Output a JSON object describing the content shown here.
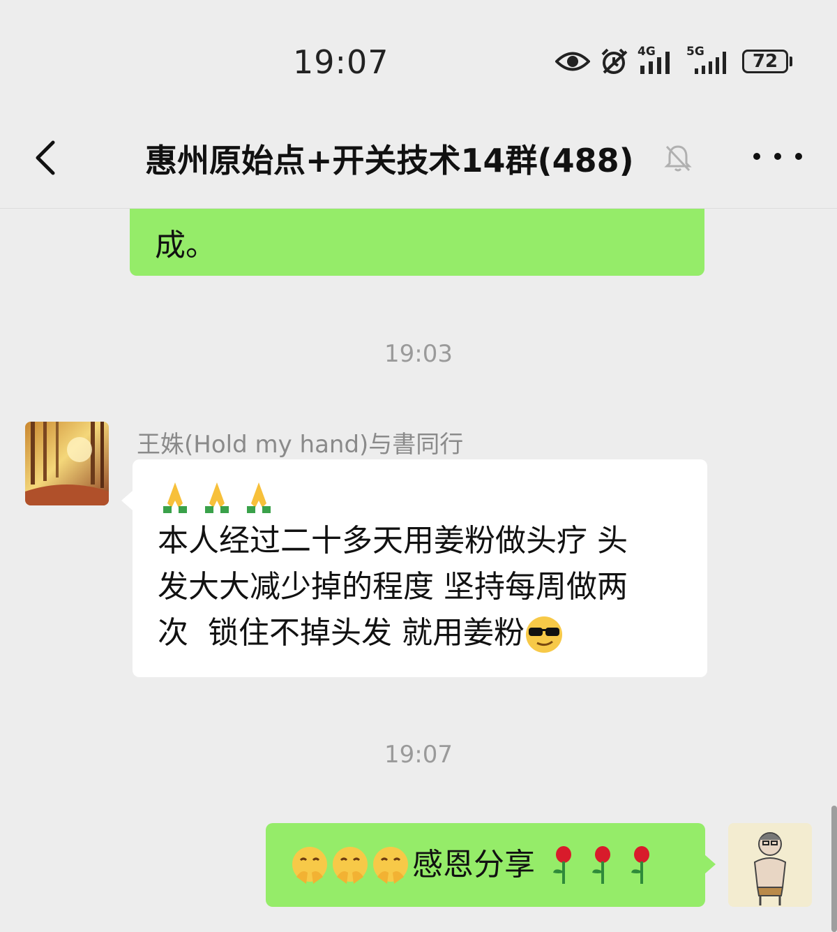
{
  "status_bar": {
    "time": "19:07",
    "signal1_label": "4G",
    "signal2_label": "5G",
    "battery": "72"
  },
  "nav": {
    "title": "惠州原始点+开关技术14群(488)"
  },
  "messages": {
    "previous_tail_text": "成。",
    "timestamp_1": "19:03",
    "incoming": {
      "sender": "王姝(Hold my hand)与書同行",
      "emoji_line": "🙏🙏🙏",
      "text_line_1": "本人经过二十多天用姜粉做头疗 头",
      "text_line_2": "发大大减少掉的程度 坚持每周做两",
      "text_line_3": "次  锁住不掉头发 就用姜粉"
    },
    "timestamp_2": "19:07",
    "outgoing": {
      "text": "感恩分享"
    }
  },
  "colors": {
    "background": "#ededed",
    "outgoing_bubble": "#95ec69",
    "incoming_bubble": "#ffffff"
  },
  "icons": [
    "eye-icon",
    "alarm-icon",
    "signal-icon",
    "battery-icon",
    "back-arrow-icon",
    "mute-bell-icon",
    "more-dots-icon",
    "pray-emoji",
    "sunglasses-emoji",
    "shush-emoji",
    "rose-emoji"
  ]
}
